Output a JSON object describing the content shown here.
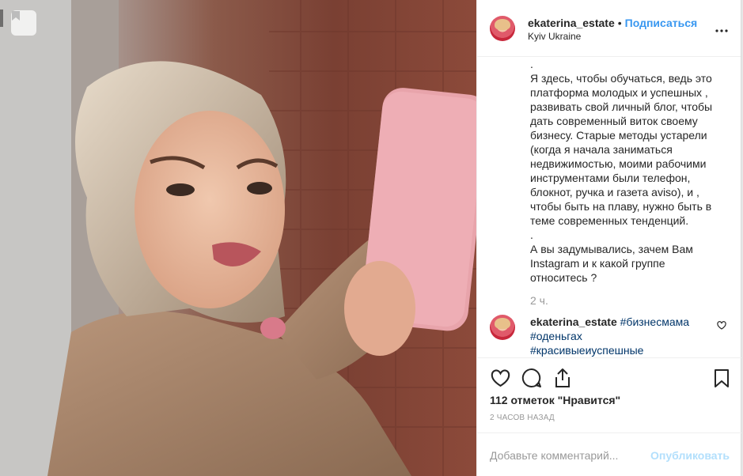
{
  "post": {
    "username": "ekaterina_estate",
    "separator": "•",
    "follow_label": "Подписаться",
    "location": "Kyiv Ukraine",
    "more_icon": "more-horizontal-icon"
  },
  "caption": {
    "text": ".\nЯ здесь, чтобы обучаться, ведь это платформа молодых и успешных , развивать свой личный блог, чтобы дать современный виток своему бизнесу. Старые методы устарели (когда я начала заниматься недвижимостью, моими рабочими инструментами были телефон, блокнот, ручка и газета aviso), и , чтобы быть на плаву, нужно быть в теме современных тенденций.\n.\nА вы задумывались, зачем Вам Instagram и к какой группе относитесь ?",
    "time": "2 ч."
  },
  "comment": {
    "username": "ekaterina_estate",
    "hashtags": [
      "#бизнесмама",
      "#оденьгах",
      "#красивыеиуспешные"
    ]
  },
  "actions": {
    "likes": "112 отметок \"Нравится\"",
    "time_ago": "2 часов назад"
  },
  "add_comment": {
    "placeholder": "Добавьте комментарий...",
    "publish_label": "Опубликовать"
  },
  "colors": {
    "link_blue": "#3897f0",
    "hashtag": "#003569",
    "publish_disabled": "#b2dffc"
  }
}
